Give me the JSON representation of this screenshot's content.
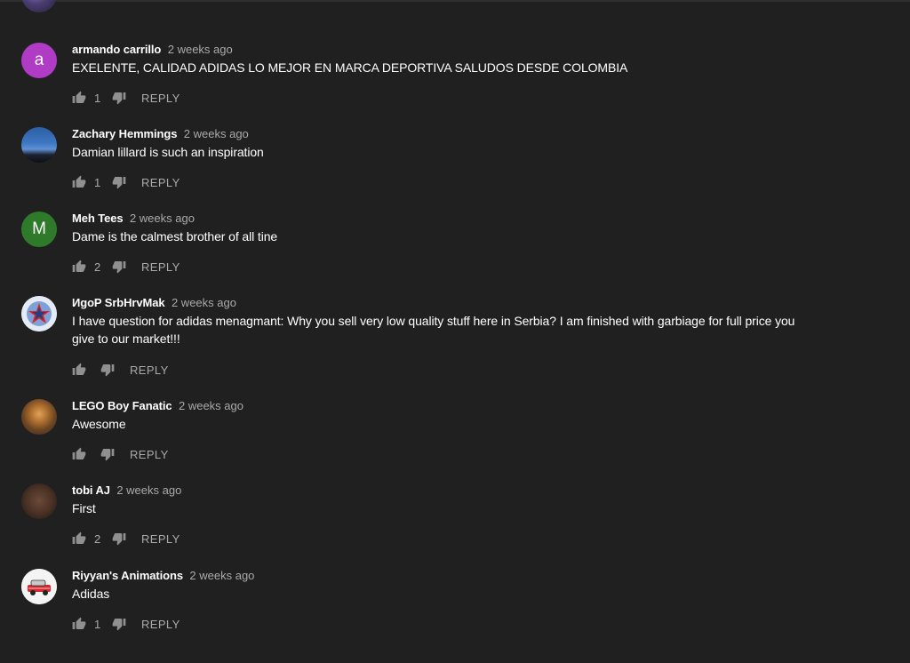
{
  "reply_label": "REPLY",
  "colors": {
    "background": "#202020",
    "secondary_text": "#aaaaaa",
    "avatar_a": "#b03cc5",
    "avatar_m": "#2f7a2a"
  },
  "comments": [
    {
      "author": "armando carrillo",
      "time": "2 weeks ago",
      "text": "EXELENTE, CALIDAD ADIDAS LO MEJOR EN MARCA DEPORTIVA SALUDOS DESDE COLOMBIA",
      "likes": "1",
      "avatar_letter": "a"
    },
    {
      "author": "Zachary Hemmings",
      "time": "2 weeks ago",
      "text": "Damian lillard is such an inspiration",
      "likes": "1"
    },
    {
      "author": "Meh Tees",
      "time": "2 weeks ago",
      "text": "Dame is the calmest brother of all tine",
      "likes": "2",
      "avatar_letter": "M"
    },
    {
      "author": "ИgoP SrbHrvMak",
      "time": "2 weeks ago",
      "text": "I have question for adidas menagmant: Why you sell very low quality stuff here in Serbia? I am finished with garbiage for full price you give to our market!!!",
      "likes": ""
    },
    {
      "author": "LEGO Boy Fanatic",
      "time": "2 weeks ago",
      "text": "Awesome",
      "likes": ""
    },
    {
      "author": "tobi AJ",
      "time": "2 weeks ago",
      "text": "First",
      "likes": "2"
    },
    {
      "author": "Riyyan's Animations",
      "time": "2 weeks ago",
      "text": "Adidas",
      "likes": "1"
    }
  ]
}
